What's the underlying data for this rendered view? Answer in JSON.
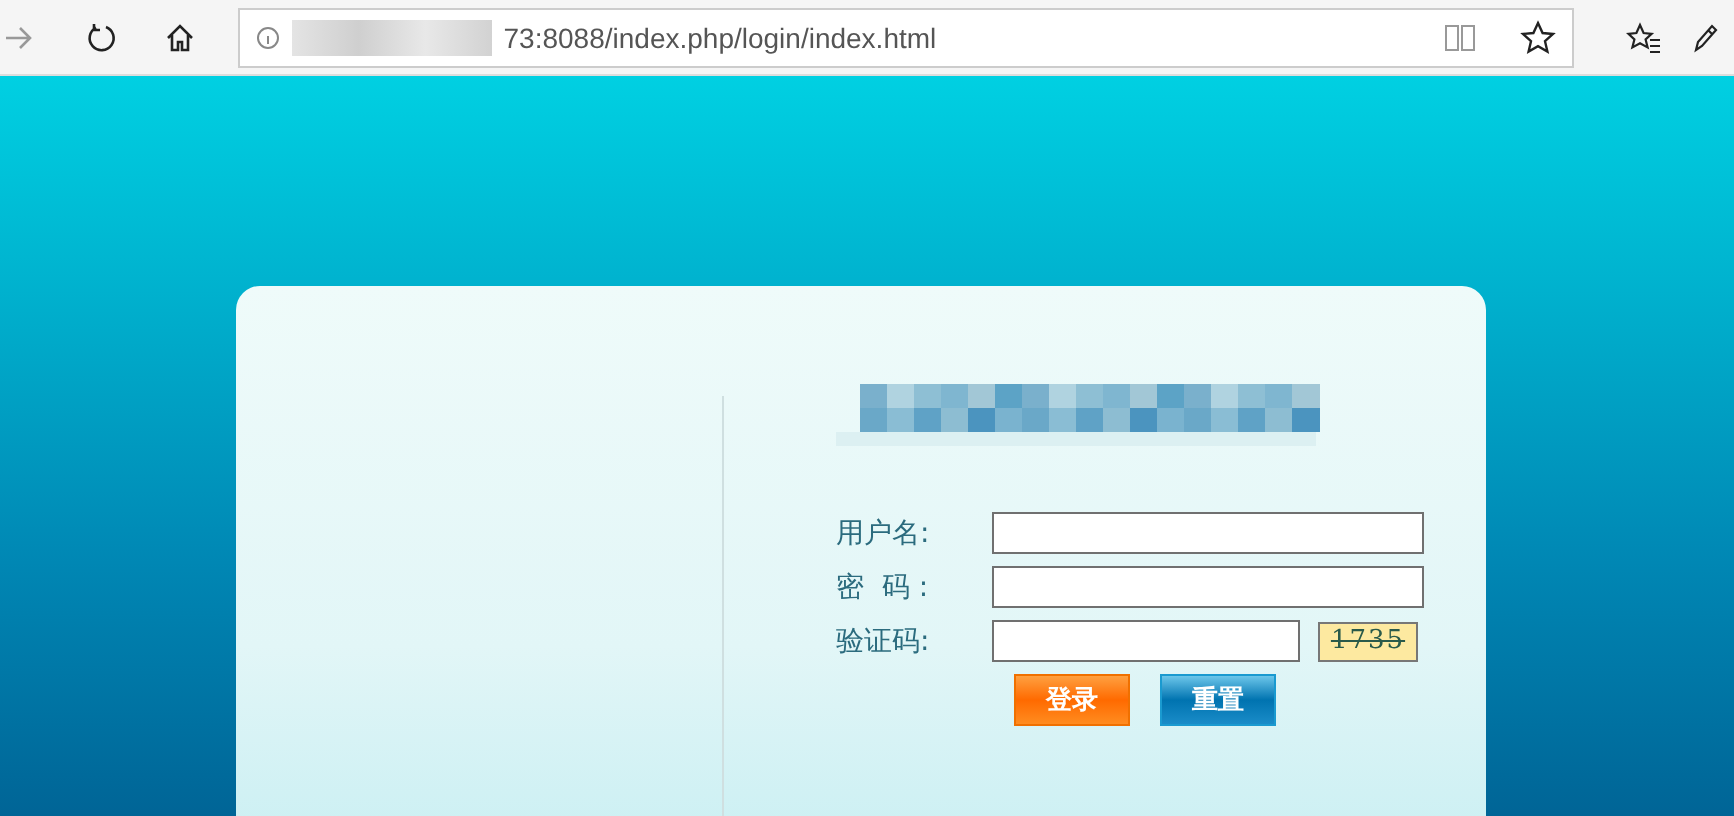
{
  "browser": {
    "url": "73:8088/index.php/login/index.html"
  },
  "login_form": {
    "fields": [
      {
        "label": "用户名:",
        "kind": "text"
      },
      {
        "label": "密  码 :",
        "kind": "password"
      },
      {
        "label": "验证码:",
        "kind": "captcha",
        "captcha": "1735"
      }
    ],
    "buttons": [
      {
        "label": "登录",
        "kind": "primary"
      },
      {
        "label": "重置",
        "kind": "secondary"
      }
    ]
  }
}
